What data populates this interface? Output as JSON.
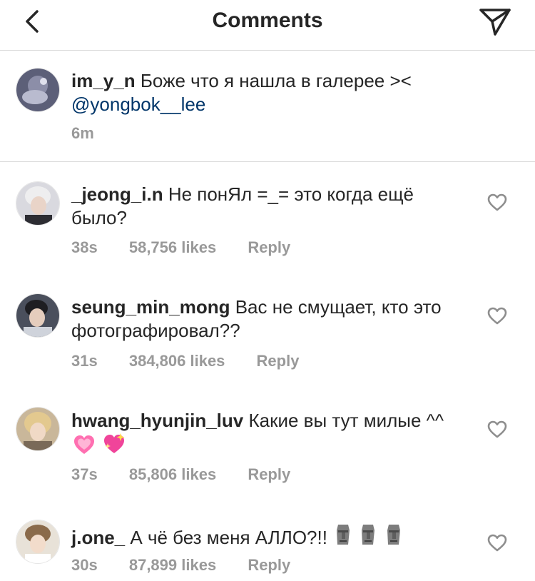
{
  "header": {
    "title": "Comments",
    "back_icon": "chevron-left-icon",
    "send_icon": "paper-plane-icon"
  },
  "caption": {
    "username": "im_y_n",
    "text": "Боже что я нашла в галерее ><",
    "mention": "@yongbok__lee",
    "time": "6m"
  },
  "comments": [
    {
      "username": "_jeong_i.n",
      "text": "Не понЯл =_= это когда ещё было?",
      "time": "38s",
      "likes": "58,756 likes",
      "reply": "Reply"
    },
    {
      "username": "seung_min_mong",
      "text": "Вас не смущает, кто это фотографировал??",
      "time": "31s",
      "likes": "384,806 likes",
      "reply": "Reply"
    },
    {
      "username": "hwang_hyunjin_luv",
      "text": "Какие вы тут милые ^^",
      "emojis": [
        "growing-heart-emoji",
        "sparkling-heart-emoji"
      ],
      "time": "37s",
      "likes": "85,806 likes",
      "reply": "Reply"
    },
    {
      "username": "j.one_",
      "text": "А чё без меня АЛЛО?!!",
      "emojis": [
        "moai-emoji",
        "moai-emoji",
        "moai-emoji"
      ],
      "time": "30s",
      "likes": "87,899 likes",
      "reply": "Reply"
    }
  ],
  "colors": {
    "text": "#262626",
    "meta": "#999999",
    "mention": "#003569",
    "divider": "#dbdbdb"
  }
}
